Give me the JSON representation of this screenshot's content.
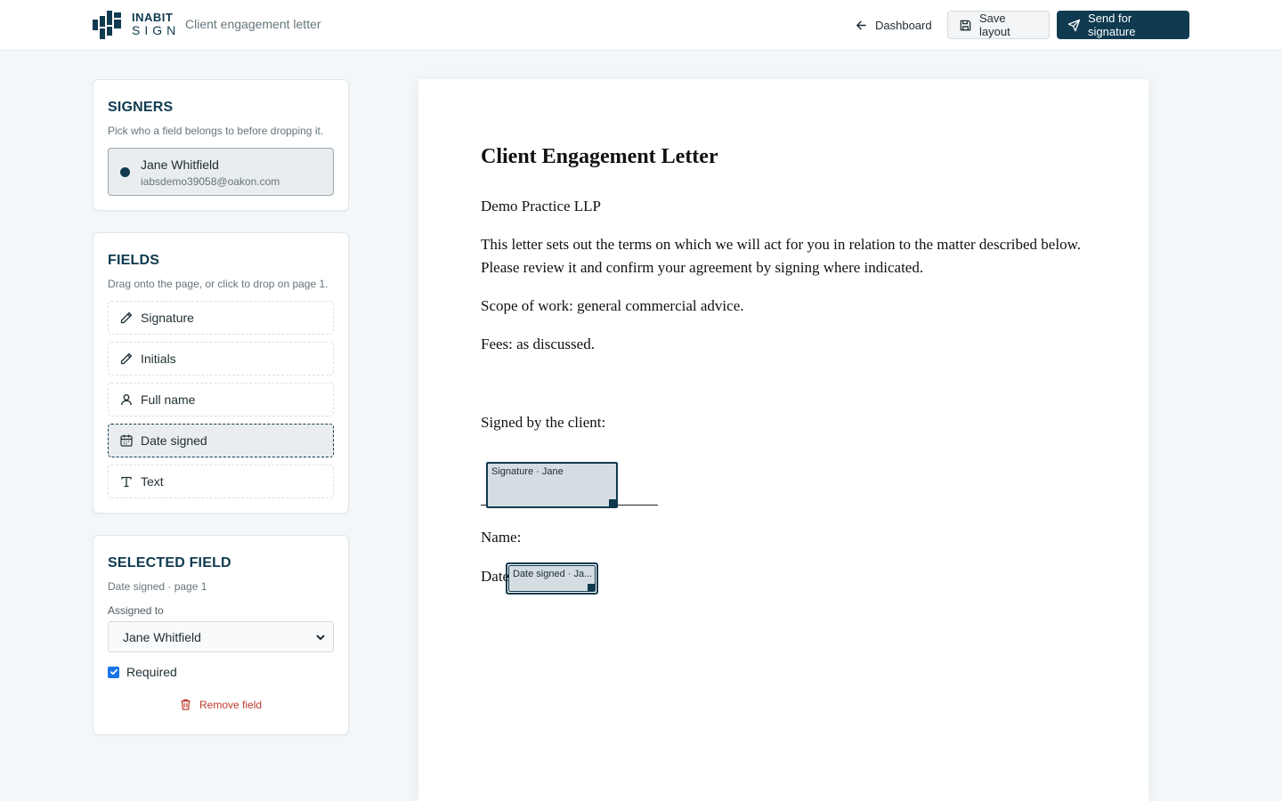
{
  "brand": {
    "line1": "INABIT",
    "line2": "SIGN"
  },
  "header": {
    "document_title": "Client engagement letter",
    "dashboard_label": "Dashboard",
    "save_label": "Save layout",
    "send_label": "Send for signature"
  },
  "signers": {
    "title": "SIGNERS",
    "subtitle": "Pick who a field belongs to before dropping it.",
    "items": [
      {
        "name": "Jane Whitfield",
        "email": "iabsdemo39058@oakon.com"
      }
    ]
  },
  "fields": {
    "title": "FIELDS",
    "subtitle": "Drag onto the page, or click to drop on page 1.",
    "items": [
      {
        "label": "Signature",
        "icon": "pen-icon"
      },
      {
        "label": "Initials",
        "icon": "pen-icon"
      },
      {
        "label": "Full name",
        "icon": "user-icon"
      },
      {
        "label": "Date signed",
        "icon": "calendar-icon",
        "active": true
      },
      {
        "label": "Text",
        "icon": "text-icon"
      }
    ]
  },
  "selected_field": {
    "title": "SELECTED FIELD",
    "subtitle": "Date signed · page 1",
    "assigned_label": "Assigned to",
    "assigned_value": "Jane Whitfield",
    "required_label": "Required",
    "required": true,
    "remove_label": "Remove field"
  },
  "document": {
    "heading": "Client Engagement Letter",
    "firm": "Demo Practice LLP",
    "intro": "This letter sets out the terms on which we will act for you in relation to the matter described below. Please review it and confirm your agreement by signing where indicated.",
    "scope": "Scope of work: general commercial advice.",
    "fees": "Fees: as discussed.",
    "signed_by": "Signed by the client:",
    "name_label": "Name:",
    "date_label": "Date:",
    "placed_signature": "Signature · Jane",
    "placed_date": "Date signed · Ja..."
  },
  "colors": {
    "brand": "#0f3a4f",
    "danger": "#c0392b",
    "checkbox": "#1a73e8"
  }
}
